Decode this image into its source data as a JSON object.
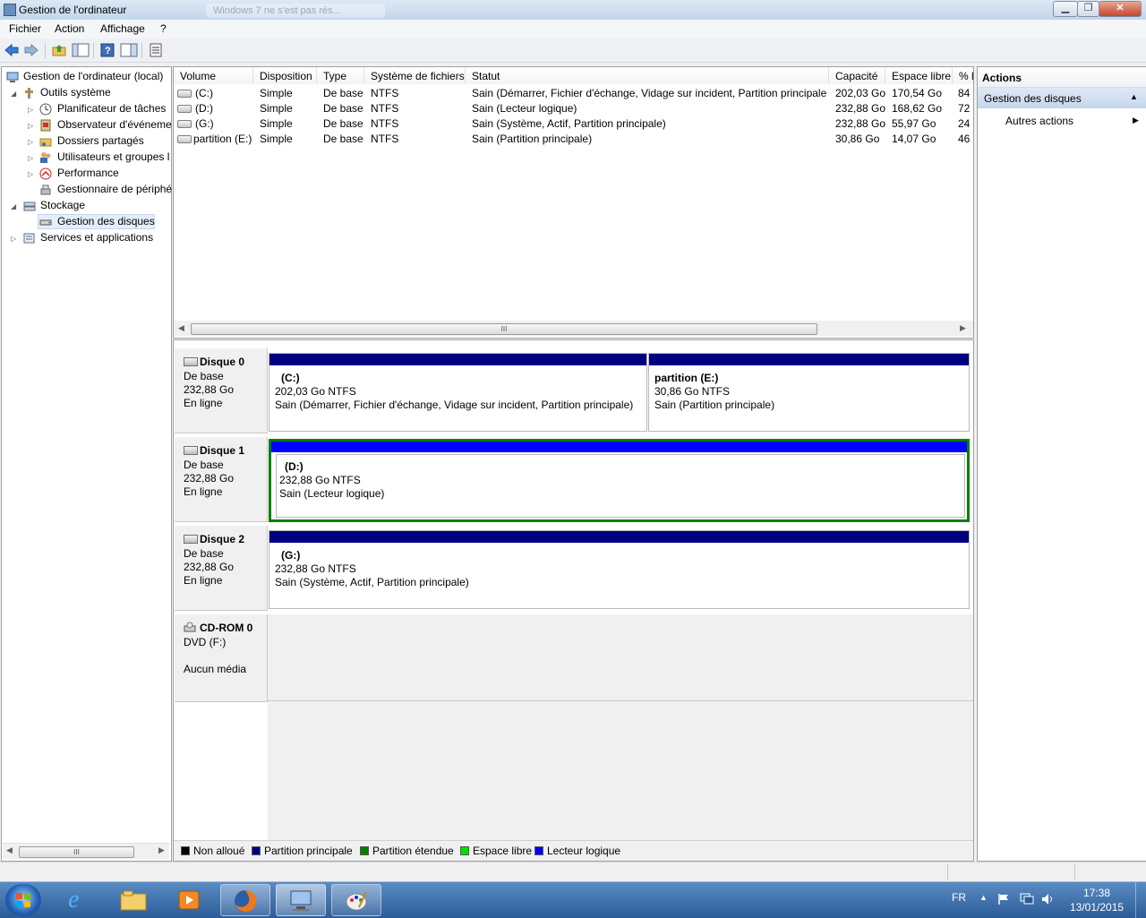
{
  "window": {
    "title": "Gestion de l'ordinateur",
    "background_tab": "Windows 7 ne s'est pas rés..."
  },
  "menu": [
    "Fichier",
    "Action",
    "Affichage",
    "?"
  ],
  "tree": {
    "root": "Gestion de l'ordinateur (local)",
    "system_tools": "Outils système",
    "task_scheduler": "Planificateur de tâches",
    "event_viewer": "Observateur d'événeme",
    "shared_folders": "Dossiers partagés",
    "users_groups": "Utilisateurs et groupes l",
    "performance": "Performance",
    "device_manager": "Gestionnaire de périphé",
    "storage": "Stockage",
    "disk_management": "Gestion des disques",
    "services": "Services et applications"
  },
  "volume_list": {
    "headers": [
      "Volume",
      "Disposition",
      "Type",
      "Système de fichiers",
      "Statut",
      "Capacité",
      "Espace libre",
      "% l"
    ],
    "rows": [
      [
        "(C:)",
        "Simple",
        "De base",
        "NTFS",
        "Sain (Démarrer, Fichier d'échange, Vidage sur incident, Partition principale)",
        "202,03 Go",
        "170,54 Go",
        "84"
      ],
      [
        "(D:)",
        "Simple",
        "De base",
        "NTFS",
        "Sain (Lecteur logique)",
        "232,88 Go",
        "168,62 Go",
        "72"
      ],
      [
        "(G:)",
        "Simple",
        "De base",
        "NTFS",
        "Sain (Système, Actif, Partition principale)",
        "232,88 Go",
        "55,97 Go",
        "24"
      ],
      [
        "partition (E:)",
        "Simple",
        "De base",
        "NTFS",
        "Sain (Partition principale)",
        "30,86 Go",
        "14,07 Go",
        "46"
      ]
    ],
    "scroll_grip": "III"
  },
  "disks": [
    {
      "name": "Disque 0",
      "type": "De base",
      "size": "232,88 Go",
      "status": "En ligne",
      "partitions": [
        {
          "title": "(C:)",
          "size": "202,03 Go NTFS",
          "status": "Sain (Démarrer, Fichier d'échange, Vidage sur incident, Partition principale)"
        },
        {
          "title": "partition  (E:)",
          "size": "30,86 Go NTFS",
          "status": "Sain (Partition principale)"
        }
      ]
    },
    {
      "name": "Disque 1",
      "type": "De base",
      "size": "232,88 Go",
      "status": "En ligne",
      "partitions": [
        {
          "title": "(D:)",
          "size": "232,88 Go NTFS",
          "status": "Sain (Lecteur logique)"
        }
      ]
    },
    {
      "name": "Disque 2",
      "type": "De base",
      "size": "232,88 Go",
      "status": "En ligne",
      "partitions": [
        {
          "title": "(G:)",
          "size": "232,88 Go NTFS",
          "status": "Sain (Système, Actif, Partition principale)"
        }
      ]
    }
  ],
  "cdrom": {
    "name": "CD-ROM 0",
    "drive": "DVD (F:)",
    "media": "Aucun média"
  },
  "legend": [
    {
      "label": "Non alloué",
      "color": "#000000"
    },
    {
      "label": "Partition principale",
      "color": "#000080"
    },
    {
      "label": "Partition étendue",
      "color": "#008000"
    },
    {
      "label": "Espace libre",
      "color": "#00e000"
    },
    {
      "label": "Lecteur logique",
      "color": "#0000ff"
    }
  ],
  "actions": {
    "header": "Actions",
    "section": "Gestion des disques",
    "more": "Autres actions"
  },
  "taskbar": {
    "language": "FR",
    "time": "17:38",
    "date": "13/01/2015"
  },
  "colors": {
    "primary_partition": "#000080",
    "logical_drive": "#0000ff",
    "extended_partition": "#008000",
    "selection": "#cde3f7"
  }
}
